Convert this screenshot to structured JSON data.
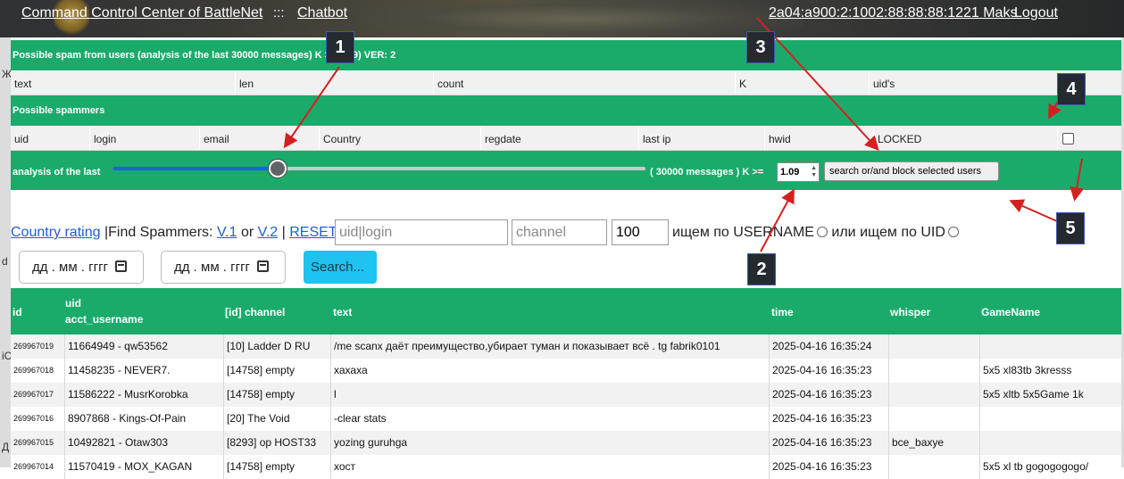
{
  "topbar": {
    "title_link": "Command Control Center of BattleNet",
    "separator": ":::",
    "chatbot_link": "Chatbot",
    "user_link": "2a04:a900:2:1002:88:88:88:1221 Maks",
    "logout_link": "Logout"
  },
  "left_fragments": [
    "Ж",
    "d",
    "iC",
    "Д"
  ],
  "spam_panel": {
    "title": "Possible spam from users (analysis of the last 30000 messages) K >= 1.09) VER: 2",
    "columns": [
      "text",
      "len",
      "count",
      "K",
      "uid's"
    ]
  },
  "spammers_panel": {
    "title": "Possible spammers",
    "columns": [
      "uid",
      "login",
      "email",
      "Country",
      "regdate",
      "last ip",
      "hwid",
      "LOCKED"
    ]
  },
  "analysis": {
    "label": "analysis of the last",
    "slider_fraction": 0.31,
    "messages_text": "( 30000 messages ) K >=",
    "k_value": "1.09",
    "block_button": "search or/and block selected users"
  },
  "filters": {
    "country_rating_link": "Country rating",
    "find_spammers_text": "|Find Spammers:",
    "v1_link": "V.1",
    "or_text": "or",
    "v2_link": "V.2",
    "pipe_text": "|",
    "reset_link": "RESET",
    "uid_placeholder": "uid|login",
    "channel_placeholder": "channel",
    "limit_value": "100",
    "search_username_text": "ищем по USERNAME",
    "search_uid_text": "или ищем по UID",
    "date_from": "дд . мм . гггг",
    "date_to": "дд . мм . гггг",
    "search_button": "Search..."
  },
  "table": {
    "headers": {
      "id": "id",
      "uid": "uid",
      "acct_username": "acct_username",
      "channel": "[id] channel",
      "text": "text",
      "time": "time",
      "whisper": "whisper",
      "gamename": "GameName"
    },
    "rows": [
      {
        "id": "269967019",
        "user": "11664949 - qw53562",
        "channel": "[10] Ladder D RU",
        "text": "/me scanx даёт преимущество,убирает туман и показывает всё . tg fabrik0101",
        "time": "2025-04-16 16:35:24",
        "whisper": "",
        "game": ""
      },
      {
        "id": "269967018",
        "user": "11458235 - NEVER7.",
        "channel": "[14758] empty",
        "text": "хахаха",
        "time": "2025-04-16 16:35:23",
        "whisper": "",
        "game": "5x5 xl83tb 3kresss"
      },
      {
        "id": "269967017",
        "user": "11586222 - MusrKorobka",
        "channel": "[14758] empty",
        "text": "l",
        "time": "2025-04-16 16:35:23",
        "whisper": "",
        "game": "5x5 xltb 5x5Game 1k"
      },
      {
        "id": "269967016",
        "user": "8907868 - Kings-Of-Pain",
        "channel": "[20] The Void",
        "text": "-clear stats",
        "time": "2025-04-16 16:35:23",
        "whisper": "",
        "game": ""
      },
      {
        "id": "269967015",
        "user": "10492821 - Otaw303",
        "channel": "[8293] op HOST33",
        "text": "yozing guruhga",
        "time": "2025-04-16 16:35:23",
        "whisper": "bce_baxye",
        "game": ""
      },
      {
        "id": "269967014",
        "user": "11570419 - MOX_KAGAN",
        "channel": "[14758] empty",
        "text": "хост",
        "time": "2025-04-16 16:35:23",
        "whisper": "",
        "game": "5x5 xl tb gogogogogo/"
      }
    ]
  },
  "annotations": [
    "1",
    "2",
    "3",
    "4",
    "5"
  ],
  "colors": {
    "accent_green": "#1aab6b",
    "link_blue": "#1a5fd8",
    "search_button": "#1ec3f0",
    "arrow_red": "#d42020",
    "slider_blue": "#1565e0"
  }
}
